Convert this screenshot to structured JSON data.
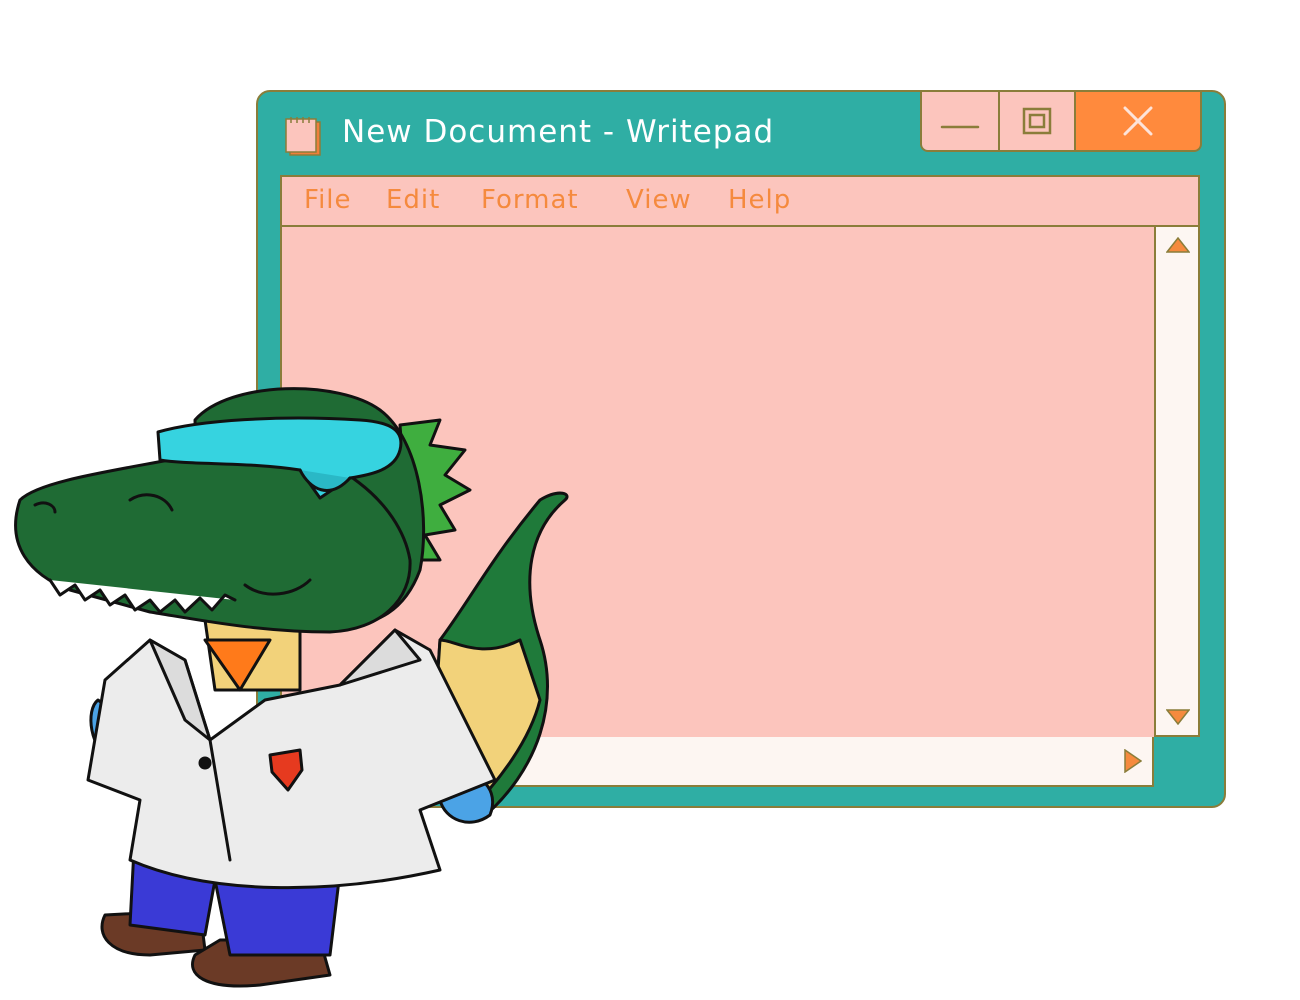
{
  "window": {
    "title": "New Document - Writepad",
    "app_icon": "notepad-icon",
    "controls": {
      "minimize": "minimize-icon",
      "maximize": "maximize-icon",
      "close": "close-icon"
    }
  },
  "menu": {
    "items": [
      {
        "label": "File"
      },
      {
        "label": "Edit"
      },
      {
        "label": "Format"
      },
      {
        "label": "View"
      },
      {
        "label": "Help"
      }
    ]
  },
  "document": {
    "text": ""
  },
  "scrollbars": {
    "up": "triangle-up-icon",
    "down": "triangle-down-icon",
    "right": "triangle-right-icon"
  },
  "colors": {
    "window": "#2faea4",
    "panel": "#fcc5bd",
    "accent": "#ff8a3d",
    "menu_text": "#f58a3e"
  }
}
